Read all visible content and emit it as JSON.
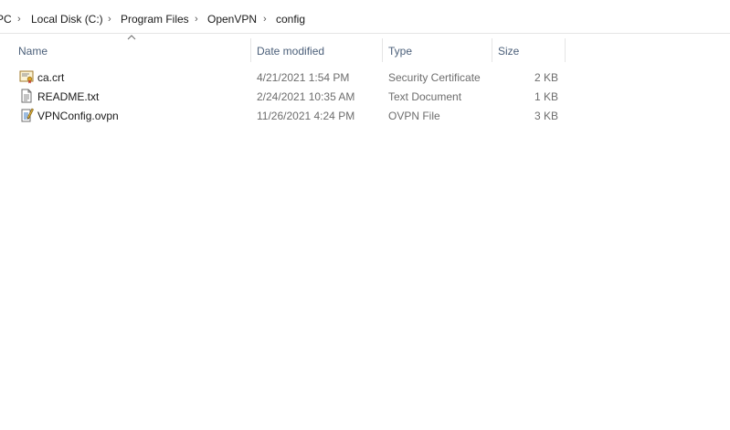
{
  "breadcrumb": {
    "items": [
      "PC",
      "Local Disk (C:)",
      "Program Files",
      "OpenVPN",
      "config"
    ]
  },
  "columns": {
    "name": "Name",
    "date_modified": "Date modified",
    "type": "Type",
    "size": "Size"
  },
  "files": [
    {
      "name": "ca.crt",
      "date": "4/21/2021 1:54 PM",
      "type": "Security Certificate",
      "size": "2 KB",
      "icon": "certificate-icon"
    },
    {
      "name": "README.txt",
      "date": "2/24/2021 10:35 AM",
      "type": "Text Document",
      "size": "1 KB",
      "icon": "text-document-icon"
    },
    {
      "name": "VPNConfig.ovpn",
      "date": "11/26/2021 4:24 PM",
      "type": "OVPN File",
      "size": "3 KB",
      "icon": "ovpn-file-icon"
    }
  ],
  "colors": {
    "header_text": "#4c607a",
    "divider": "#e5e5e5"
  }
}
